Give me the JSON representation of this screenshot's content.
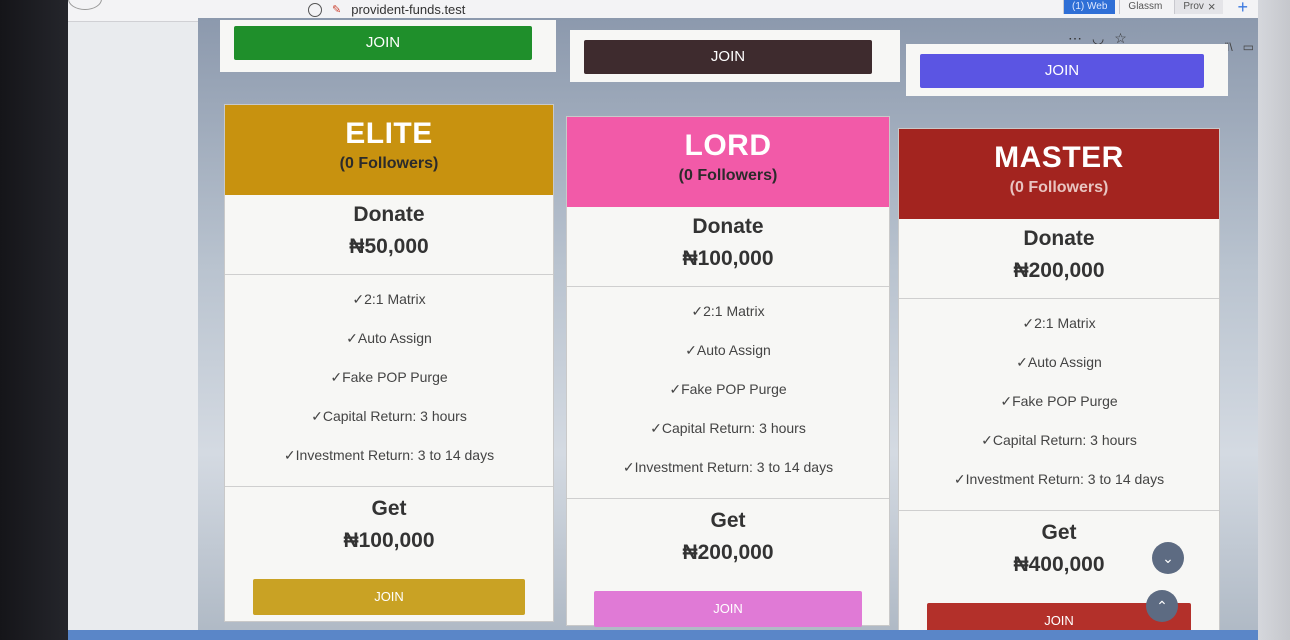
{
  "browser": {
    "url": "provident-funds.test",
    "tabs": [
      {
        "label": "(1) Web",
        "style": "blue"
      },
      {
        "label": "Glassm",
        "style": "normal"
      },
      {
        "label": "Prov",
        "style": "active"
      }
    ],
    "tab_close": "×",
    "new_tab": "+",
    "toolbar_icons": [
      "more-icon",
      "pocket-icon",
      "star-icon"
    ],
    "right_icons": [
      "library-icon",
      "sidebar-icon"
    ]
  },
  "top_row": [
    {
      "join_label": "JOIN",
      "color": "#1f8f2b"
    },
    {
      "join_label": "JOIN",
      "color": "#3e2b2e"
    },
    {
      "join_label": "JOIN",
      "color": "#5b55e3"
    }
  ],
  "plans": [
    {
      "name": "ELITE",
      "followers": "(0 Followers)",
      "color": "#c8920f",
      "donate_label": "Donate",
      "donate_amount": "₦50,000",
      "features": [
        "✓2:1 Matrix",
        "✓Auto Assign",
        "✓Fake POP Purge",
        "✓Capital Return: 3 hours",
        "✓Investment Return: 3 to 14 days"
      ],
      "get_label": "Get",
      "get_amount": "₦100,000",
      "join_label": "JOIN",
      "join_color": "#c9a224"
    },
    {
      "name": "LORD",
      "followers": "(0 Followers)",
      "color": "#f25aa8",
      "donate_label": "Donate",
      "donate_amount": "₦100,000",
      "features": [
        "✓2:1 Matrix",
        "✓Auto Assign",
        "✓Fake POP Purge",
        "✓Capital Return: 3 hours",
        "✓Investment Return: 3 to 14 days"
      ],
      "get_label": "Get",
      "get_amount": "₦200,000",
      "join_label": "JOIN",
      "join_color": "#e07ad6"
    },
    {
      "name": "MASTER",
      "followers": "(0 Followers)",
      "color": "#a3241f",
      "donate_label": "Donate",
      "donate_amount": "₦200,000",
      "features": [
        "✓2:1 Matrix",
        "✓Auto Assign",
        "✓Fake POP Purge",
        "✓Capital Return: 3 hours",
        "✓Investment Return: 3 to 14 days"
      ],
      "get_label": "Get",
      "get_amount": "₦400,000",
      "join_label": "JOIN",
      "join_color": "#b3302a"
    }
  ],
  "scroll": {
    "down": "⌄",
    "up": "⌃"
  }
}
